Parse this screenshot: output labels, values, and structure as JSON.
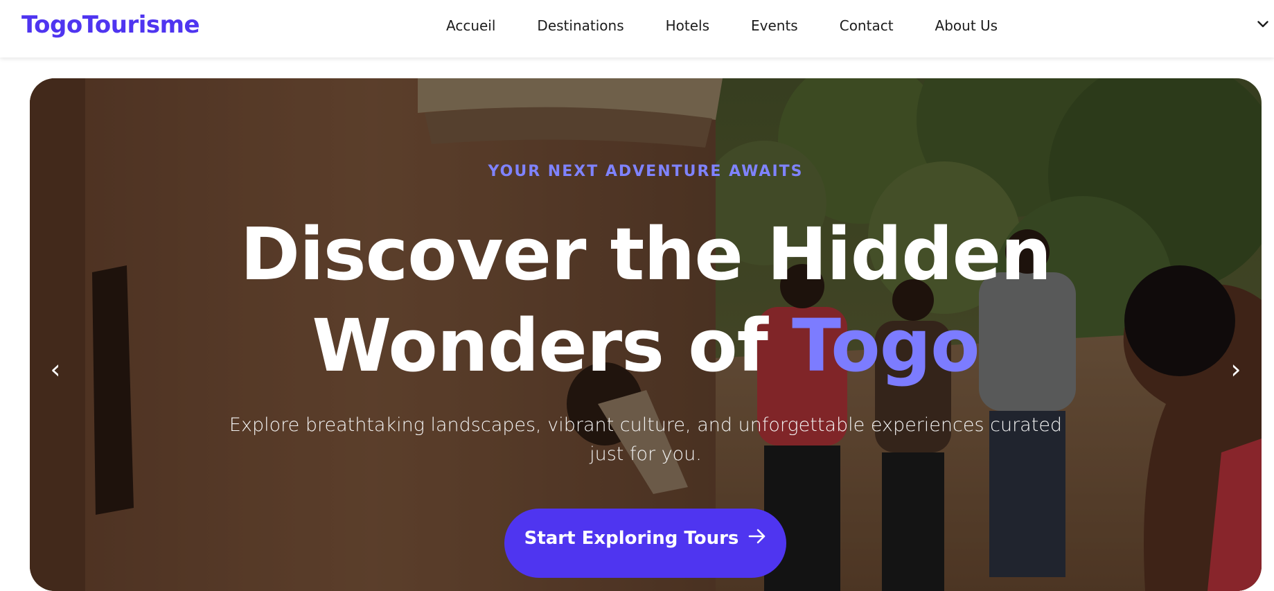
{
  "brand": {
    "name": "TogoTourisme",
    "color": "#4f35f0"
  },
  "nav": {
    "items": [
      {
        "label": "Accueil"
      },
      {
        "label": "Destinations"
      },
      {
        "label": "Hotels"
      },
      {
        "label": "Events"
      },
      {
        "label": "Contact"
      },
      {
        "label": "About Us"
      }
    ],
    "toggle_icon": "chevron-down-icon"
  },
  "hero": {
    "eyebrow": "YOUR NEXT ADVENTURE AWAITS",
    "headline_line1": "Discover the Hidden",
    "headline_line2_prefix": "Wonders of ",
    "headline_accent": "Togo",
    "subtitle": "Explore breathtaking landscapes, vibrant culture, and unforgettable experiences curated just for you.",
    "cta_label": "Start Exploring Tours",
    "cta_icon": "arrow-right-icon",
    "prev_label": "‹",
    "next_label": "›",
    "accent_color": "#7c7cff",
    "cta_color": "#4f35f0"
  }
}
